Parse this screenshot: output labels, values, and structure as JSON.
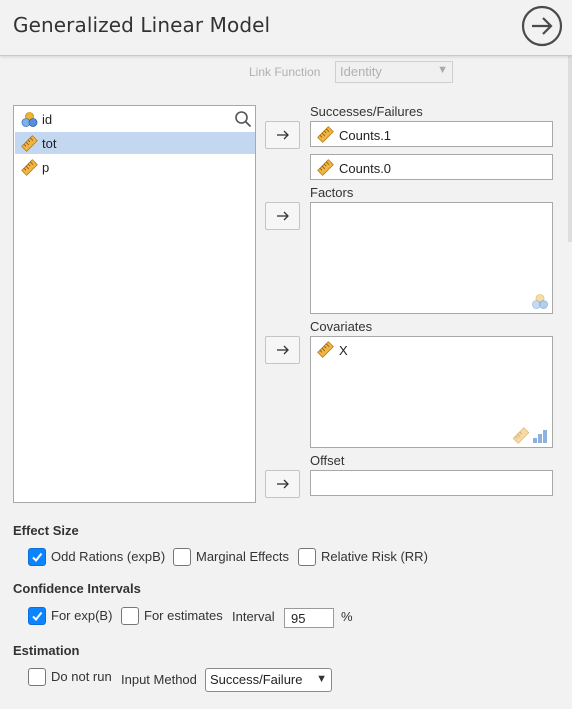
{
  "header": {
    "title": "Generalized Linear Model"
  },
  "link_function": {
    "label": "Link Function",
    "value": "Identity"
  },
  "variables": [
    {
      "name": "id",
      "type": "nominal",
      "selected": false
    },
    {
      "name": "tot",
      "type": "continuous",
      "selected": true
    },
    {
      "name": "p",
      "type": "continuous",
      "selected": false
    }
  ],
  "targets": {
    "successes_failures": {
      "label": "Successes/Failures",
      "items": [
        "Counts.1",
        "Counts.0"
      ]
    },
    "factors": {
      "label": "Factors",
      "items": []
    },
    "covariates": {
      "label": "Covariates",
      "items": [
        "X"
      ]
    },
    "offset": {
      "label": "Offset",
      "items": []
    }
  },
  "effect_size": {
    "heading": "Effect Size",
    "options": [
      {
        "label": "Odd Rations (expB)",
        "checked": true
      },
      {
        "label": "Marginal Effects",
        "checked": false
      },
      {
        "label": "Relative Risk (RR)",
        "checked": false
      }
    ]
  },
  "confidence_intervals": {
    "heading": "Confidence Intervals",
    "exp_b": {
      "label": "For exp(B)",
      "checked": true
    },
    "estimates": {
      "label": "For estimates",
      "checked": false
    },
    "interval_label": "Interval",
    "interval_value": "95",
    "interval_unit": "%"
  },
  "estimation": {
    "heading": "Estimation",
    "do_not_run": {
      "label": "Do not run",
      "checked": false
    },
    "input_method_label": "Input Method",
    "input_method_value": "Success/Failure"
  },
  "colors": {
    "accent": "#0a84ff",
    "selected_row": "#c4d7f0",
    "nominal_blue": "#4a7fd4",
    "ruler_orange": "#e8a23c"
  }
}
